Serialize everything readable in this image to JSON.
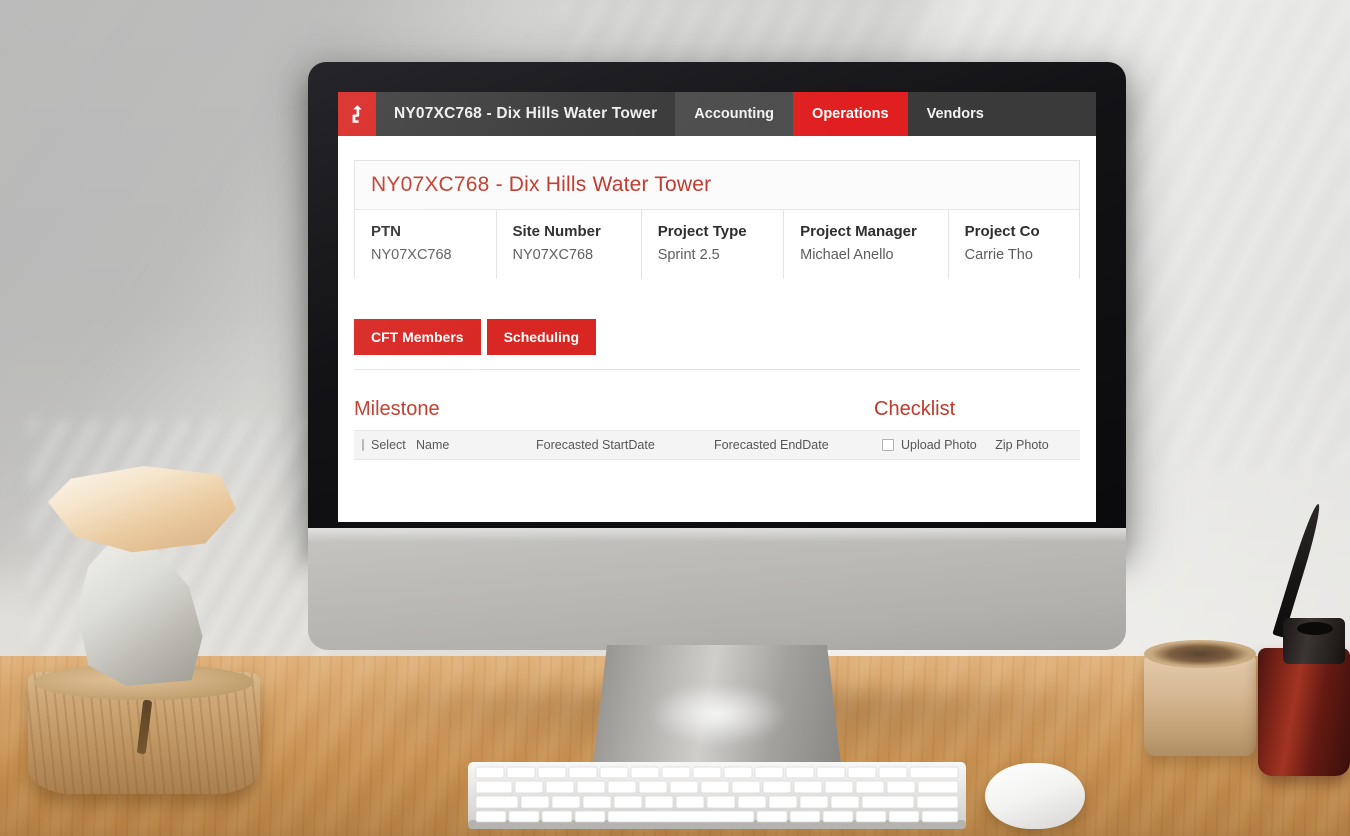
{
  "scene": {
    "description": "iMac desktop computer on a wooden desk showing a project operations web application",
    "objects": [
      "stacked-stones-on-wood-stump",
      "wooden-bowl",
      "dark-red-glass-vase-with-feather",
      "white-keyboard",
      "white-mouse"
    ]
  },
  "colors": {
    "brand_red": "#d8231f",
    "active_tab_red": "#e02020",
    "nav_dark": "#3a3a3a",
    "nav_item_gray": "#4d4d4d",
    "heading_red": "#c0392b",
    "desk_wood": "#d49a59"
  },
  "navbar": {
    "logo_icon": "arrow-up-hook-logo-icon",
    "project_title": "NY07XC768 - Dix Hills Water Tower",
    "items": [
      {
        "label": "Accounting",
        "active": false
      },
      {
        "label": "Operations",
        "active": true
      },
      {
        "label": "Vendors",
        "active": false
      }
    ]
  },
  "panel": {
    "title": "NY07XC768 - Dix Hills Water Tower",
    "fields": [
      {
        "label": "PTN",
        "value": "NY07XC768"
      },
      {
        "label": "Site Number",
        "value": "NY07XC768"
      },
      {
        "label": "Project Type",
        "value": "Sprint 2.5"
      },
      {
        "label": "Project Manager",
        "value": "Michael Anello"
      },
      {
        "label": "Project Co",
        "value": "Carrie Tho"
      }
    ]
  },
  "buttons": [
    {
      "label": "CFT Members"
    },
    {
      "label": "Scheduling"
    }
  ],
  "milestone": {
    "title": "Milestone",
    "select_all_checkbox": "unchecked",
    "columns": [
      "Select",
      "Name",
      "Forecasted StartDate",
      "Forecasted EndDate"
    ],
    "rows": []
  },
  "checklist": {
    "title": "Checklist",
    "select_all_checkbox": "unchecked",
    "columns": [
      "Upload Photo",
      "Zip Photo"
    ],
    "rows": []
  }
}
